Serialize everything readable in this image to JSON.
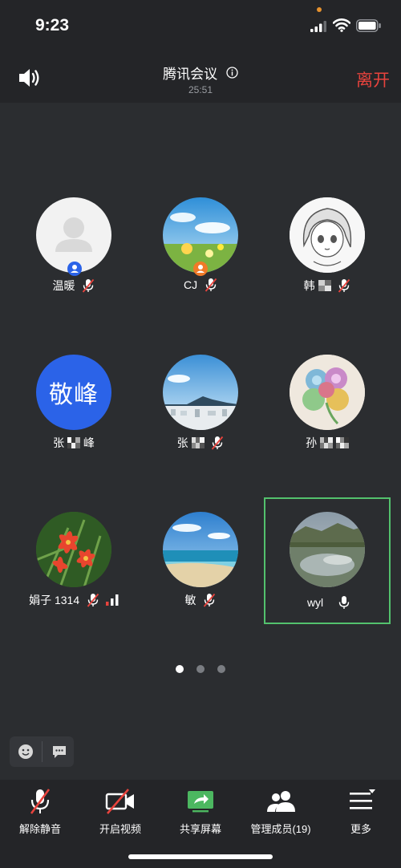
{
  "status_bar": {
    "time": "9:23"
  },
  "header": {
    "title": "腾讯会议",
    "timer": "25:51",
    "leave_label": "离开"
  },
  "participants": [
    {
      "name": "温暖",
      "mic": "muted",
      "avatar": "default"
    },
    {
      "name": "CJ",
      "mic": "muted",
      "avatar": "sky-flowers"
    },
    {
      "name": "韩",
      "mic": "muted",
      "avatar": "anime-girl"
    },
    {
      "name": "张",
      "name_suffix": "峰",
      "mic": "none",
      "avatar": "initials",
      "avatar_text": "敬峰"
    },
    {
      "name": "张",
      "mic": "muted",
      "avatar": "coast-city"
    },
    {
      "name": "孙",
      "mic": "none",
      "avatar": "quilling-art"
    },
    {
      "name": "娟子 1314",
      "mic": "muted",
      "avatar": "red-flowers",
      "network": "signal-bars"
    },
    {
      "name": "敏",
      "mic": "muted",
      "avatar": "beach"
    },
    {
      "name": "wyl",
      "mic": "active",
      "avatar": "lake",
      "speaking": true
    }
  ],
  "pagination": {
    "pages": 3,
    "current": 1
  },
  "toolbar": {
    "unmute": "解除静音",
    "start_video": "开启视频",
    "share_screen": "共享屏幕",
    "manage_members": "管理成员(19)",
    "more": "更多"
  },
  "colors": {
    "accent_red": "#e8433d",
    "active_green": "#53c16d",
    "badge_blue": "#2b63e8",
    "badge_orange": "#f07a28"
  }
}
